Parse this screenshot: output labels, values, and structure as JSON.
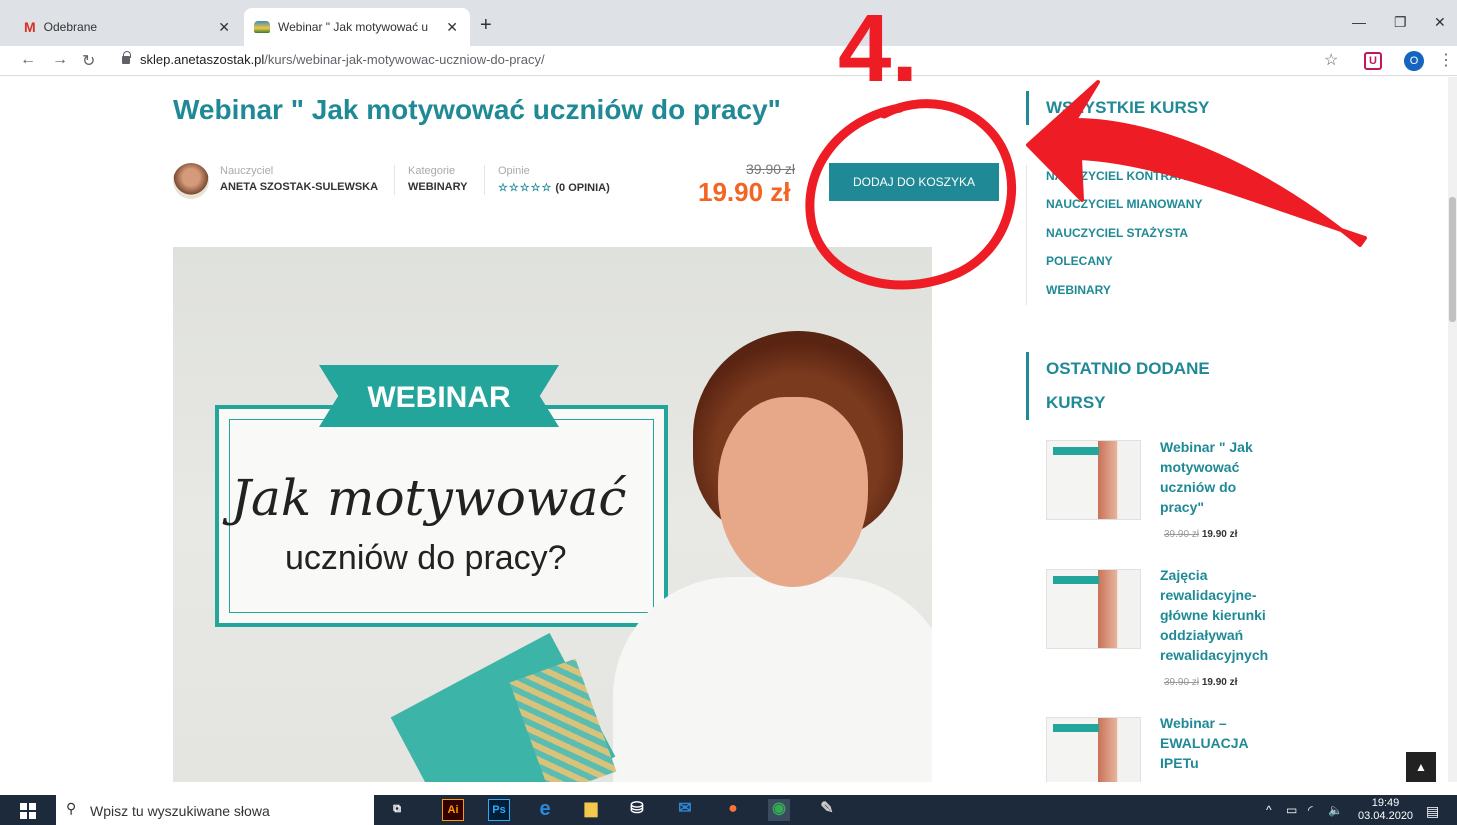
{
  "browser": {
    "tabs": [
      {
        "title": "Odebrane",
        "icon": "gmail-icon",
        "active": false
      },
      {
        "title": "Webinar \" Jak motywować ucznió",
        "icon": "site-favicon-icon",
        "active": true
      }
    ],
    "url_host": "sklep.anetaszostak.pl",
    "url_path": "/kurs/webinar-jak-motywowac-uczniow-do-pracy/",
    "profile_initial": "O"
  },
  "course": {
    "title": "Webinar \" Jak motywować uczniów do pracy\"",
    "teacher_label": "Nauczyciel",
    "teacher_name": "ANETA SZOSTAK-SULEWSKA",
    "category_label": "Kategorie",
    "category_value": "WEBINARY",
    "reviews_label": "Opinie",
    "reviews_stars": "☆☆☆☆☆",
    "reviews_value": "(0 OPINIA)",
    "old_price": "39.90 zł",
    "new_price": "19.90 zł",
    "cart_button": "DODAJ DO KOSZYKA"
  },
  "hero": {
    "ribbon": "WEBINAR",
    "script_line": "Jak motywować",
    "sub_line": "uczniów do pracy?"
  },
  "sidebar": {
    "categories_heading": "WSZYSTKIE KURSY",
    "categories": [
      "NAUCZYCIEL KONTRAKTOWY",
      "NAUCZYCIEL MIANOWANY",
      "NAUCZYCIEL STAŻYSTA",
      "POLECANY",
      "WEBINARY"
    ],
    "recent_heading_1": "OSTATNIO DODANE",
    "recent_heading_2": "KURSY",
    "recent": [
      {
        "title": "Webinar \" Jak motywować uczniów do pracy\"",
        "old_price": "39.90 zł",
        "new_price": "19.90 zł"
      },
      {
        "title": "Zajęcia rewalidacyjne- główne kierunki oddziaływań rewalidacyjnych",
        "old_price": "39.90 zł",
        "new_price": "19.90 zł"
      },
      {
        "title": "Webinar – EWALUACJA IPETu",
        "old_price": "",
        "new_price": ""
      }
    ],
    "back_to_top": "▲"
  },
  "annotation": {
    "step_number": "4.",
    "color": "#ee1c24"
  },
  "taskbar": {
    "search_placeholder": "Wpisz tu wyszukiwane słowa",
    "time": "19:49",
    "date": "03.04.2020"
  }
}
